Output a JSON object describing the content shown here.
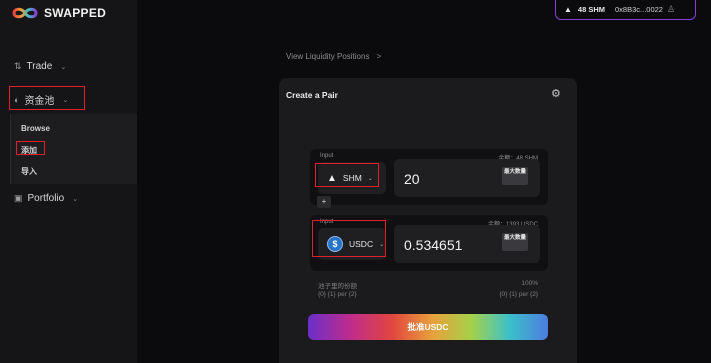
{
  "brand": {
    "name": "SWAPPED"
  },
  "sidebar": {
    "trade_label": "Trade",
    "pool_label": "资金池",
    "portfolio_label": "Portfolio",
    "pool_submenu": [
      "Browse",
      "添加",
      "导入"
    ]
  },
  "wallet": {
    "balance": "48 SHM",
    "address": "0x8B3c...0022"
  },
  "breadcrumb": {
    "label": "View Liquidity Positions",
    "chevron": ">"
  },
  "card": {
    "title": "Create a Pair",
    "input1": {
      "label": "Input",
      "balance": "余额：48 SHM",
      "token": "SHM",
      "amount": "20",
      "max_label": "最大数量"
    },
    "input2": {
      "label": "Input",
      "balance": "余额：1393 USDC",
      "token": "USDC",
      "token_glyph": "$",
      "amount": "0.534651",
      "max_label": "最大数量"
    },
    "plus": "+",
    "share_label": "池子里的份额",
    "share_value": "100%",
    "ratio_left": "{0} {1} per {2}",
    "ratio_right": "{0} {1} per {2}",
    "approve_label": "批准USDC"
  },
  "colors": {
    "highlight_box": "#e0202a",
    "wallet_border": "#8a3fd0",
    "usdc": "#2775ca"
  },
  "icons": {
    "logo": "infinity-logo-icon",
    "trade": "arrows-icon",
    "pool": "pool-icon",
    "portfolio": "portfolio-icon",
    "settings": "gear-icon",
    "user": "user-icon",
    "shm": "shm-triangle-icon",
    "usdc": "usdc-coin-icon"
  }
}
